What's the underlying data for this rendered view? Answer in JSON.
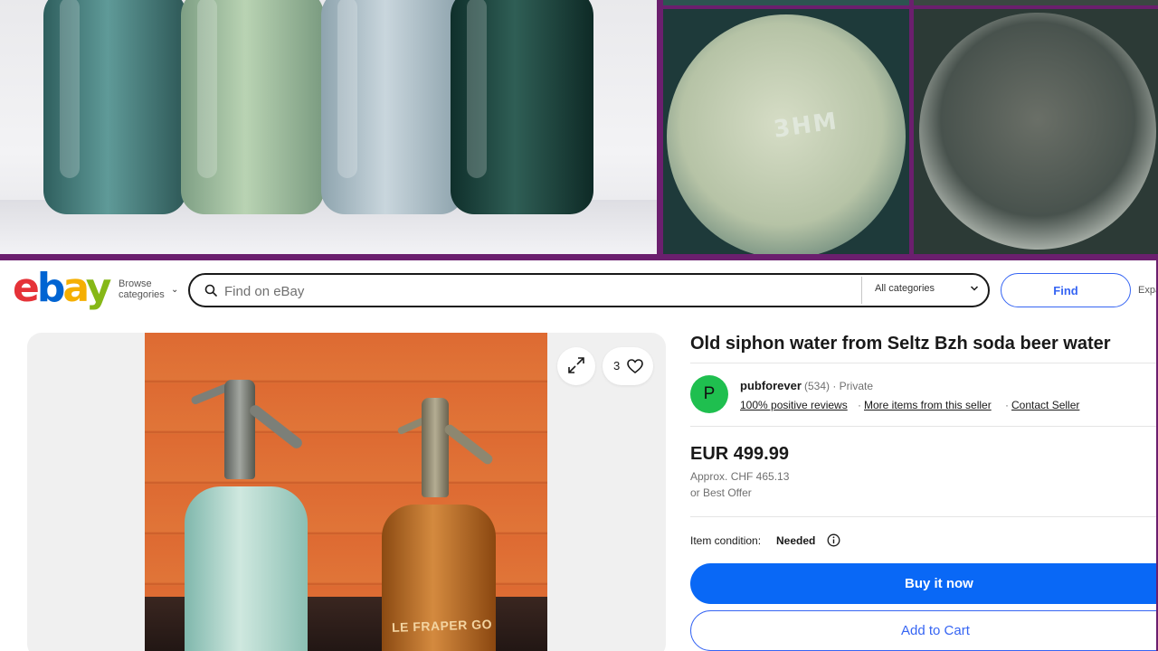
{
  "header": {
    "logo": {
      "e": "e",
      "b": "b",
      "a": "a",
      "y": "y"
    },
    "browse_line1": "Browse",
    "browse_line2": "categories",
    "search_placeholder": "Find on eBay",
    "category_select": "All categories",
    "find_label": "Find",
    "advanced_label": "Expa"
  },
  "collage": {
    "base_engraving": "3HM",
    "photos": [
      "bottles",
      "bottle-base-light",
      "bottle-base-dark"
    ]
  },
  "gallery": {
    "watch_count": "3",
    "bottle_label": "LE FRAPER GO"
  },
  "listing": {
    "title": "Old siphon water from Seltz Bzh soda beer water",
    "seller": {
      "initial": "P",
      "name": "pubforever",
      "meta": "(534) · Private",
      "link_reviews": "100% positive reviews",
      "link_more": "More items from this seller",
      "link_contact": "Contact Seller",
      "separator": "·"
    },
    "price": "EUR 499.99",
    "approx": "Approx. CHF 465.13",
    "best_offer": "or Best Offer",
    "condition_label": "Item condition:",
    "condition_value": "Needed"
  },
  "actions": {
    "buy_now": "Buy it now",
    "add_to_cart": "Add to Cart"
  },
  "colors": {
    "brand_red": "#e53238",
    "brand_blue": "#0064d2",
    "brand_yellow": "#f5af02",
    "brand_green": "#86b817",
    "primary_button": "#0968f6",
    "link_blue": "#3665f3",
    "frame_purple": "#6b1f6e",
    "avatar_green": "#1fbf4f"
  },
  "icons": [
    "search-icon",
    "chevron-down-icon",
    "expand-icon",
    "heart-icon",
    "info-icon"
  ]
}
